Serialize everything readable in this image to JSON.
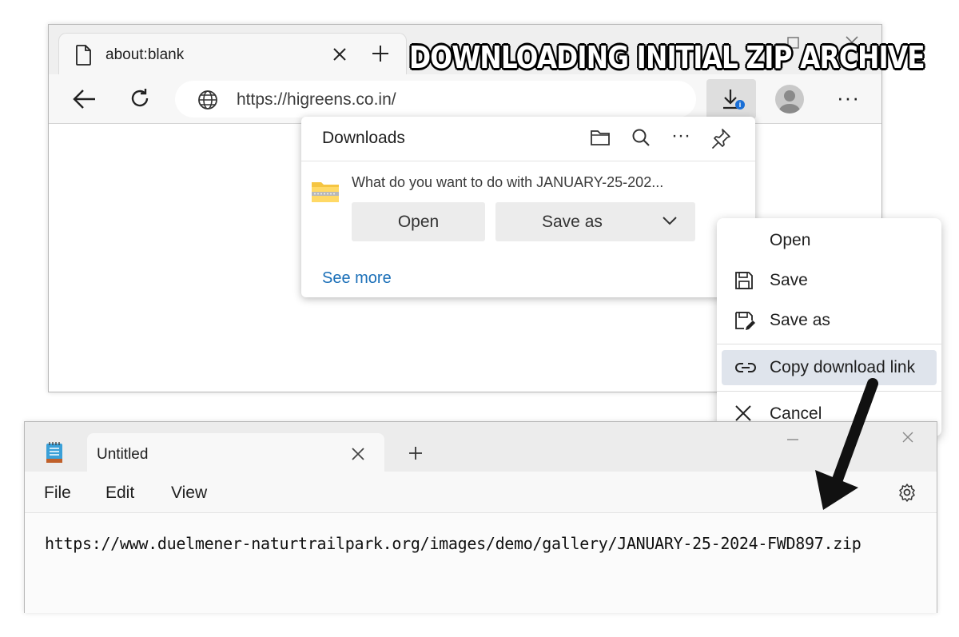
{
  "overlay": {
    "title": "DOWNLOADING INITIAL ZIP ARCHIVE"
  },
  "browser": {
    "tab_title": "about:blank",
    "address": "https://higreens.co.in/",
    "download_badge": "i"
  },
  "downloads": {
    "title": "Downloads",
    "prompt": "What do you want to do with JANUARY-25-202...",
    "open_label": "Open",
    "save_as_label": "Save as",
    "see_more": "See more"
  },
  "context_menu": {
    "items": [
      {
        "label": "Open",
        "icon": "none"
      },
      {
        "label": "Save",
        "icon": "save-icon"
      },
      {
        "label": "Save as",
        "icon": "save-as-icon"
      },
      {
        "label": "Copy download link",
        "icon": "link-icon",
        "highlighted": true
      },
      {
        "label": "Cancel",
        "icon": "close-icon"
      }
    ]
  },
  "notepad": {
    "tab_title": "Untitled",
    "menu": [
      "File",
      "Edit",
      "View"
    ],
    "content": "https://www.duelmener-naturtrailpark.org/images/demo/gallery/JANUARY-25-2024-FWD897.zip"
  },
  "colors": {
    "accent_link": "#1a6fb8",
    "menu_highlight": "#dfe4ec",
    "badge": "#1a6fd6"
  }
}
